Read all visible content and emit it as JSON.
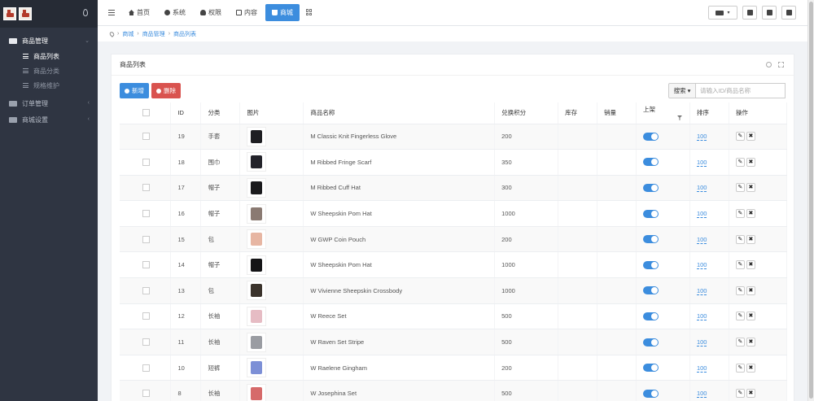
{
  "sidebar": {
    "groups": [
      {
        "label": "商品管理",
        "active": true,
        "items": [
          {
            "label": "商品列表",
            "active": true
          },
          {
            "label": "商品分类",
            "active": false
          },
          {
            "label": "规格维护",
            "active": false
          }
        ]
      },
      {
        "label": "订单管理",
        "active": false
      },
      {
        "label": "商城设置",
        "active": false
      }
    ]
  },
  "topnav": {
    "items": [
      {
        "label": "首页",
        "icon": "home-icon"
      },
      {
        "label": "系统",
        "icon": "gear-icon"
      },
      {
        "label": "权限",
        "icon": "user-icon"
      },
      {
        "label": "内容",
        "icon": "content-icon"
      },
      {
        "label": "商城",
        "icon": "cart-icon",
        "active": true
      }
    ]
  },
  "breadcrumb": {
    "items": [
      "商城",
      "商品管理",
      "商品列表"
    ]
  },
  "panel": {
    "title": "商品列表"
  },
  "toolbar": {
    "add_label": "新增",
    "delete_label": "删除"
  },
  "search": {
    "button_label": "搜索",
    "placeholder": "请输入ID/商品名称"
  },
  "table": {
    "headers": [
      "ID",
      "分类",
      "图片",
      "商品名称",
      "兑换积分",
      "库存",
      "销量",
      "上架",
      "排序",
      "操作"
    ],
    "rows": [
      {
        "id": "19",
        "category": "手套",
        "name": "M Classic Knit Fingerless Glove",
        "points": "200",
        "stock": "",
        "sales": "",
        "on_sale": true,
        "sort": "100",
        "thumb_color": "#1e1e22"
      },
      {
        "id": "18",
        "category": "围巾",
        "name": "M Ribbed Fringe Scarf",
        "points": "350",
        "stock": "",
        "sales": "",
        "on_sale": true,
        "sort": "100",
        "thumb_color": "#23232a"
      },
      {
        "id": "17",
        "category": "帽子",
        "name": "M Ribbed Cuff Hat",
        "points": "300",
        "stock": "",
        "sales": "",
        "on_sale": true,
        "sort": "100",
        "thumb_color": "#1a1a1d"
      },
      {
        "id": "16",
        "category": "帽子",
        "name": "W Sheepskin Pom Hat",
        "points": "1000",
        "stock": "",
        "sales": "",
        "on_sale": true,
        "sort": "100",
        "thumb_color": "#8a7a72"
      },
      {
        "id": "15",
        "category": "包",
        "name": "W GWP Coin Pouch",
        "points": "200",
        "stock": "",
        "sales": "",
        "on_sale": true,
        "sort": "100",
        "thumb_color": "#e7b6a3"
      },
      {
        "id": "14",
        "category": "帽子",
        "name": "W Sheepskin Pom Hat",
        "points": "1000",
        "stock": "",
        "sales": "",
        "on_sale": true,
        "sort": "100",
        "thumb_color": "#141416"
      },
      {
        "id": "13",
        "category": "包",
        "name": "W Vivienne Sheepskin Crossbody",
        "points": "1000",
        "stock": "",
        "sales": "",
        "on_sale": true,
        "sort": "100",
        "thumb_color": "#3b332c"
      },
      {
        "id": "12",
        "category": "长袖",
        "name": "W Reece Set",
        "points": "500",
        "stock": "",
        "sales": "",
        "on_sale": true,
        "sort": "100",
        "thumb_color": "#e6bcc4"
      },
      {
        "id": "11",
        "category": "长袖",
        "name": "W Raven Set Stripe",
        "points": "500",
        "stock": "",
        "sales": "",
        "on_sale": true,
        "sort": "100",
        "thumb_color": "#9a9ca2"
      },
      {
        "id": "10",
        "category": "短裤",
        "name": "W Raelene Gingham",
        "points": "200",
        "stock": "",
        "sales": "",
        "on_sale": true,
        "sort": "100",
        "thumb_color": "#7c8fd6"
      },
      {
        "id": "8",
        "category": "长袖",
        "name": "W Josephina Set",
        "points": "500",
        "stock": "",
        "sales": "",
        "on_sale": true,
        "sort": "100",
        "thumb_color": "#d66a6a"
      }
    ],
    "op_edit_glyph": "✎",
    "op_delete_glyph": "✖"
  },
  "colors": {
    "primary": "#3c8dde",
    "danger": "#d9534f",
    "sidebar_bg": "#2f3542"
  }
}
